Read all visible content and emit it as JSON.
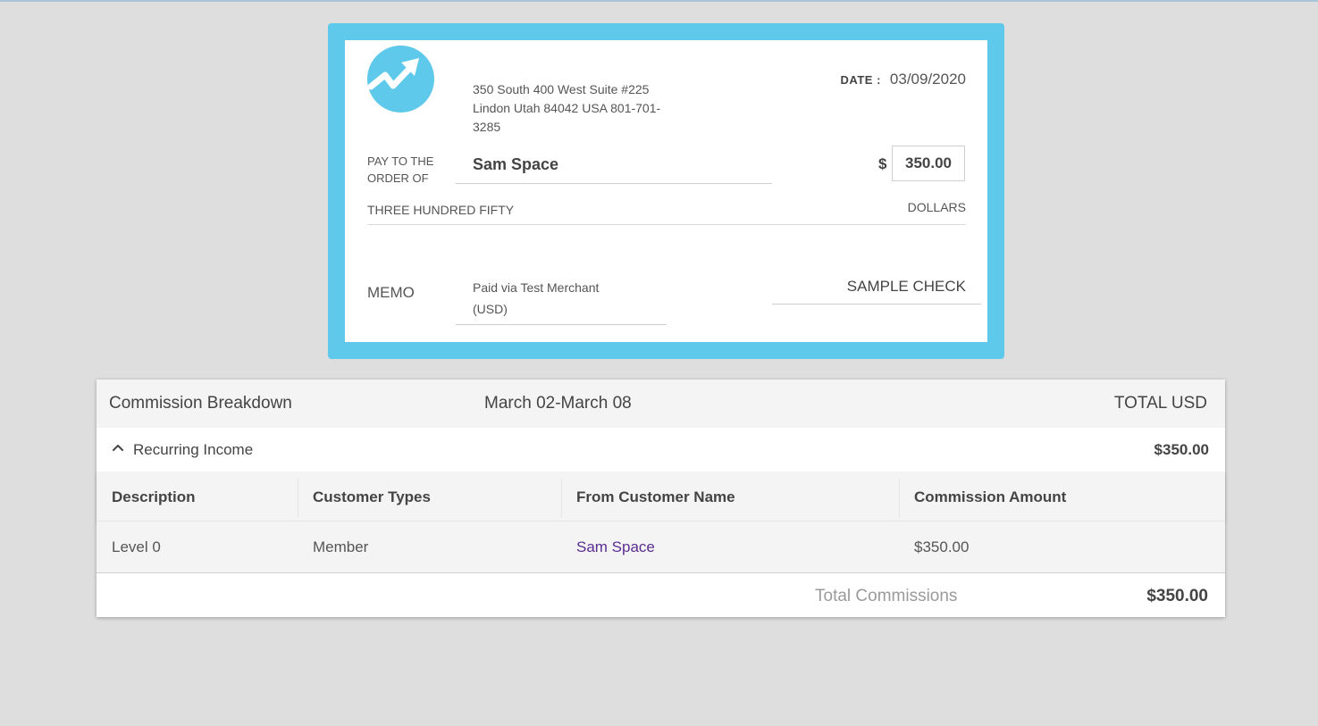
{
  "colors": {
    "check_frame": "#5ec9ea",
    "background": "#dedede",
    "link": "#5a2d91"
  },
  "check": {
    "logo_icon": "trending-up-arrow-icon",
    "address": "350 South 400 West   Suite #225   Lindon   Utah   84042   USA   801-701-3285",
    "date_label": "DATE :",
    "date": "03/09/2020",
    "payto_label": "PAY TO THE ORDER OF",
    "payee": "Sam Space",
    "dollar_sign": "$",
    "amount": "350.00",
    "amount_words": "THREE HUNDRED FIFTY",
    "dollars_label": "DOLLARS",
    "memo_label": "MEMO",
    "memo_line1": "Paid via  Test Merchant",
    "memo_line2": "(USD)",
    "signature": "SAMPLE CHECK"
  },
  "breakdown": {
    "title": "Commission Breakdown",
    "date_range": "March 02-March 08",
    "total_label": "TOTAL  USD",
    "group": {
      "icon": "chevron-up-icon",
      "name": "Recurring Income",
      "amount": "$350.00"
    },
    "columns": [
      "Description",
      "Customer Types",
      "From Customer Name",
      "Commission Amount"
    ],
    "rows": [
      {
        "description": "Level 0",
        "customer_type": "Member",
        "customer_name": "Sam Space",
        "amount": "$350.00"
      }
    ],
    "total_commissions_label": "Total Commissions",
    "total_commissions_value": "$350.00"
  }
}
